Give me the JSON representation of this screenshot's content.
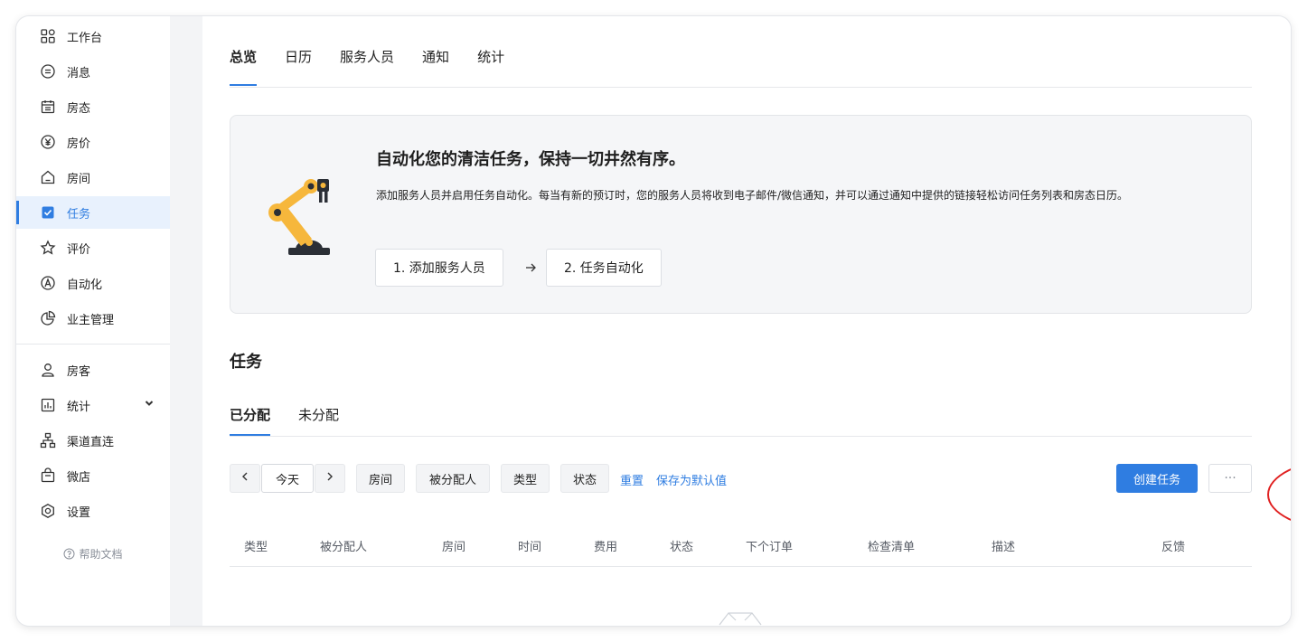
{
  "sidebar": {
    "items": [
      {
        "label": "工作台",
        "icon": "grid-icon"
      },
      {
        "label": "消息",
        "icon": "message-icon"
      },
      {
        "label": "房态",
        "icon": "calendar-icon"
      },
      {
        "label": "房价",
        "icon": "yen-icon"
      },
      {
        "label": "房间",
        "icon": "house-icon"
      },
      {
        "label": "任务",
        "icon": "checkbox-icon",
        "active": true
      },
      {
        "label": "评价",
        "icon": "star-icon"
      },
      {
        "label": "自动化",
        "icon": "automation-icon"
      },
      {
        "label": "业主管理",
        "icon": "pie-icon"
      },
      {
        "label": "房客",
        "icon": "user-icon"
      },
      {
        "label": "统计",
        "icon": "stats-icon",
        "expandable": true
      },
      {
        "label": "渠道直连",
        "icon": "network-icon"
      },
      {
        "label": "微店",
        "icon": "bag-icon"
      },
      {
        "label": "设置",
        "icon": "settings-icon"
      }
    ],
    "help": "帮助文档"
  },
  "top_tabs": [
    "总览",
    "日历",
    "服务人员",
    "通知",
    "统计"
  ],
  "promo": {
    "title": "自动化您的清洁任务，保持一切井然有序。",
    "description": "添加服务人员并启用任务自动化。每当有新的预订时，您的服务人员将收到电子邮件/微信通知，并可以通过通知中提供的链接轻松访问任务列表和房态日历。",
    "step1": "1. 添加服务人员",
    "step2": "2. 任务自动化"
  },
  "section_title": "任务",
  "sub_tabs": [
    "已分配",
    "未分配"
  ],
  "toolbar": {
    "today": "今天",
    "filters": [
      "房间",
      "被分配人",
      "类型",
      "状态"
    ],
    "reset": "重置",
    "save_default": "保存为默认值",
    "create": "创建任务",
    "more": "···"
  },
  "table": {
    "columns": [
      "类型",
      "被分配人",
      "房间",
      "时间",
      "费用",
      "状态",
      "下个订单",
      "检查清单",
      "描述",
      "反馈"
    ]
  },
  "colors": {
    "accent": "#2f7de1",
    "highlight": "#e02020"
  }
}
